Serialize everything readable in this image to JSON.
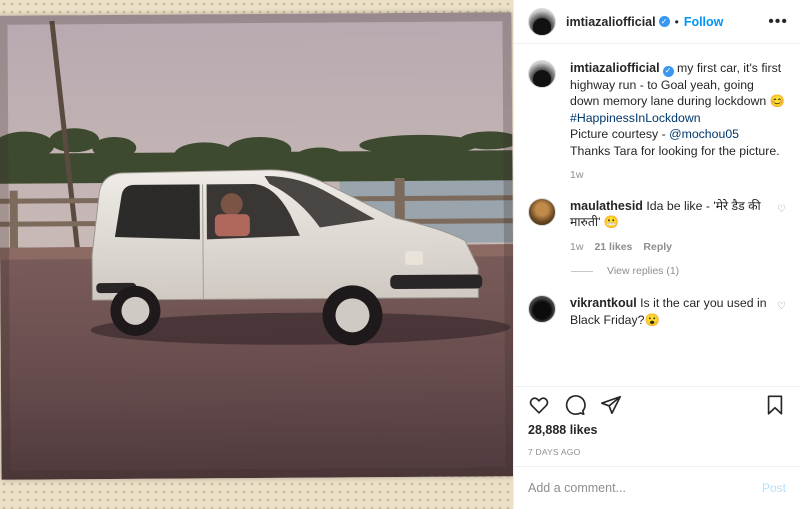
{
  "post": {
    "username": "imtiazaliofficial",
    "follow_label": "Follow",
    "separator": "•",
    "verified_icon": "verified-badge-icon",
    "more_icon": "more-options-icon"
  },
  "caption": {
    "username": "imtiazaliofficial",
    "text": "my first car, it's first highway run - to Goal yeah, going down memory lane during lockdown 😊",
    "hashtag": "#HappinessInLockdown",
    "courtesy_prefix": "Picture courtesy - ",
    "mention": "@mochou05",
    "thanks": "Thanks Tara for looking for the picture.",
    "time": "1w"
  },
  "comments": [
    {
      "username": "maulathesid",
      "text": "Ida be like - 'मेरे डैड की मारुती' 😬",
      "time": "1w",
      "likes": "21 likes",
      "reply_label": "Reply",
      "view_replies": "View replies (1)"
    },
    {
      "username": "vikrantkoul",
      "text": "Is it the car you used in Black Friday?😮"
    }
  ],
  "actions": {
    "likes": "28,888 likes",
    "posted_ago": "7 DAYS AGO",
    "icons": [
      "heart-icon",
      "comment-icon",
      "share-icon",
      "bookmark-icon"
    ]
  },
  "add_comment": {
    "placeholder": "Add a comment...",
    "post_label": "Post"
  },
  "colors": {
    "accent": "#0095f6",
    "post_disabled": "#b2dffc",
    "secondary_text": "#8e8e8e"
  }
}
